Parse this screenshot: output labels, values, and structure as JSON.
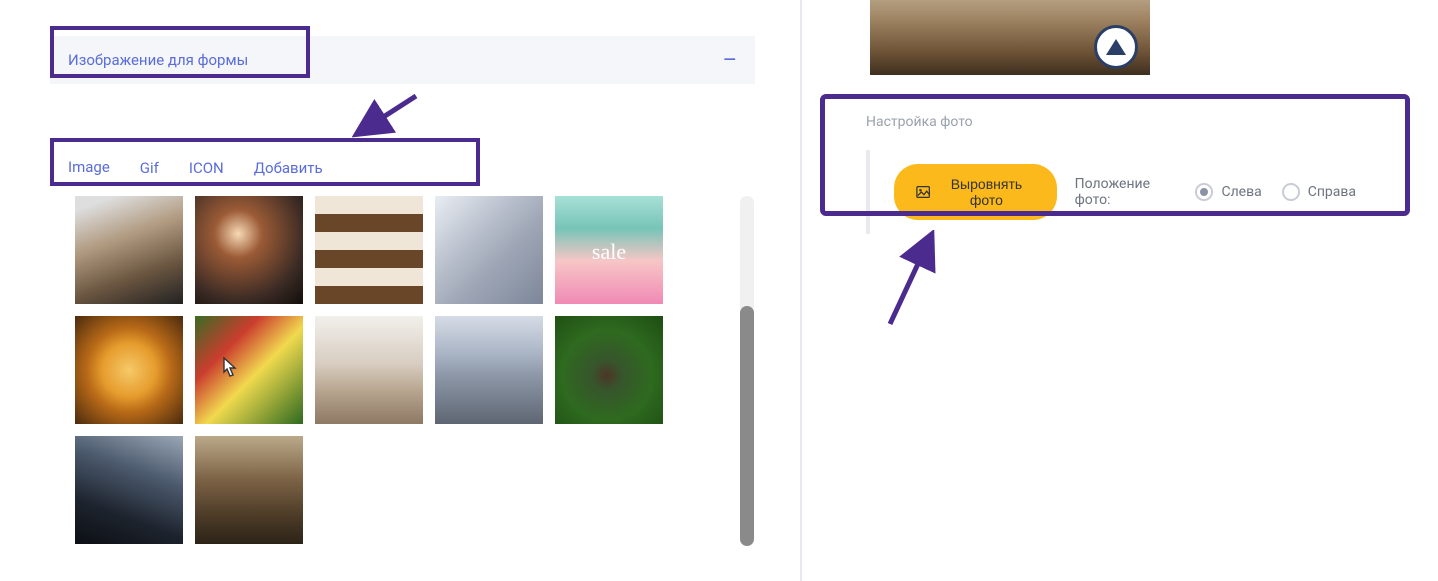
{
  "left": {
    "section_title": "Изображение для формы",
    "collapse_glyph": "–",
    "tabs": {
      "image": "Image",
      "gif": "Gif",
      "icon": "ICON",
      "add": "Добавить"
    }
  },
  "right": {
    "settings_title": "Настройка фото",
    "align_button": "Выровнять фото",
    "position_label": "Положение фото:",
    "radio_left": "Слева",
    "radio_right": "Справа"
  }
}
